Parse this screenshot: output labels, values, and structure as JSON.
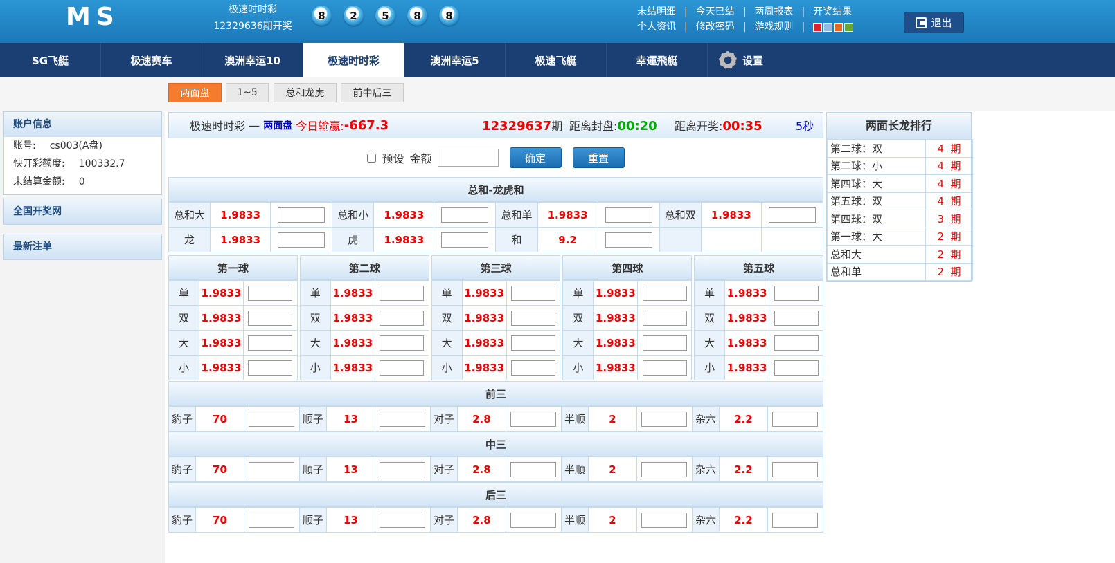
{
  "header": {
    "logo": "MS",
    "lottery_name": "极速时时彩",
    "draw_period": "12329636期开奖",
    "balls": [
      "8",
      "2",
      "5",
      "8",
      "8"
    ],
    "links_row1": [
      "未结明细",
      "今天已结",
      "两周报表",
      "开奖结果"
    ],
    "links_row2": [
      "个人资讯",
      "修改密码",
      "游戏规则"
    ],
    "theme_colors": [
      "#e0232b",
      "#9bb9dd",
      "#e86a1a",
      "#6aa62c"
    ],
    "logout": "退出"
  },
  "nav": {
    "tabs": [
      "SG飞艇",
      "极速赛车",
      "澳洲幸运10",
      "极速时时彩",
      "澳洲幸运5",
      "极速飞艇",
      "幸運飛艇"
    ],
    "active": "极速时时彩",
    "settings": "设置"
  },
  "subtabs": [
    "两面盘",
    "1~5",
    "总和龙虎",
    "前中后三"
  ],
  "sidebar": {
    "account_title": "账户信息",
    "account_label": "账号:",
    "account_value": "cs003(A盘)",
    "quota_label": "快开彩额度:",
    "quota_value": "100332.7",
    "unsettled_label": "未结算金额:",
    "unsettled_value": "0",
    "site_link": "全国开奖网",
    "latest_bets": "最新注单"
  },
  "info": {
    "game": "极速时时彩",
    "dash": "—",
    "mode": "两面盘",
    "winloss_label": "今日输赢:",
    "winloss": "-667.3",
    "period": "12329637",
    "period_suffix": "期",
    "close_label": "距离封盘:",
    "close_time": "00:20",
    "open_label": "距离开奖:",
    "open_time": "00:35",
    "refresh": "5秒"
  },
  "form": {
    "preset": "预设",
    "amount": "金额",
    "confirm": "确定",
    "reset": "重置"
  },
  "sum_section": {
    "title": "总和-龙虎和",
    "row1": [
      [
        "总和大",
        "1.9833"
      ],
      [
        "总和小",
        "1.9833"
      ],
      [
        "总和单",
        "1.9833"
      ],
      [
        "总和双",
        "1.9833"
      ]
    ],
    "row2": [
      [
        "龙",
        "1.9833"
      ],
      [
        "虎",
        "1.9833"
      ],
      [
        "和",
        "9.2"
      ]
    ]
  },
  "balls_section": {
    "titles": [
      "第一球",
      "第二球",
      "第三球",
      "第四球",
      "第五球"
    ],
    "labels": [
      "单",
      "双",
      "大",
      "小"
    ],
    "odds": "1.9833"
  },
  "three_sections": [
    {
      "title": "前三"
    },
    {
      "title": "中三"
    },
    {
      "title": "后三"
    }
  ],
  "three_items": [
    [
      "豹子",
      "70"
    ],
    [
      "顺子",
      "13"
    ],
    [
      "对子",
      "2.8"
    ],
    [
      "半顺",
      "2"
    ],
    [
      "杂六",
      "2.2"
    ]
  ],
  "ranking": {
    "title": "两面长龙排行",
    "rows": [
      [
        "第二球：双",
        "4",
        "期"
      ],
      [
        "第二球：小",
        "4",
        "期"
      ],
      [
        "第四球：大",
        "4",
        "期"
      ],
      [
        "第五球：双",
        "4",
        "期"
      ],
      [
        "第四球：双",
        "3",
        "期"
      ],
      [
        "第一球：大",
        "2",
        "期"
      ],
      [
        "总和大",
        "2",
        "期"
      ],
      [
        "总和单",
        "2",
        "期"
      ]
    ]
  }
}
